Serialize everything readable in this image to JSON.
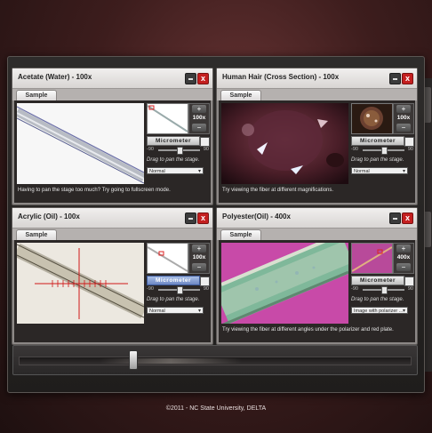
{
  "footer": {
    "copyright": "©2011 - NC State University, DELTA"
  },
  "common": {
    "tab_sample": "Sample",
    "micrometer": "Micrometer",
    "slider_min": "-90",
    "slider_max": "90",
    "drag_hint": "Drag to pan the stage.",
    "zoom_in": "+",
    "zoom_out": "−",
    "minimize_icon": "minimize-icon",
    "close_icon": "close-icon",
    "close_glyph": "x"
  },
  "panels": [
    {
      "title": "Acetate (Water) - 100x",
      "zoom": "100x",
      "mode": "Normal",
      "tip": "Having to pan the stage too much? Try going to fullscreen mode.",
      "micrometer_active": false,
      "rotation": 0
    },
    {
      "title": "Human Hair (Cross Section) - 100x",
      "zoom": "100x",
      "mode": "Normal",
      "tip": "Try viewing the fiber at different magnifications.",
      "micrometer_active": false,
      "rotation": 0
    },
    {
      "title": "Acrylic (Oil) - 100x",
      "zoom": "100x",
      "mode": "Normal",
      "tip": "",
      "micrometer_active": true,
      "rotation": 0
    },
    {
      "title": "Polyester(Oil) - 400x",
      "zoom": "400x",
      "mode": "Image with polarizer ...",
      "tip": "Try viewing the fiber at different angles under the polarizer and red plate.",
      "micrometer_active": false,
      "rotation": 0
    }
  ],
  "colors": {
    "close_red": "#c41f1f",
    "micrometer_active_blue": "#6d88c4",
    "background_maroon": "#5a2a2a"
  }
}
